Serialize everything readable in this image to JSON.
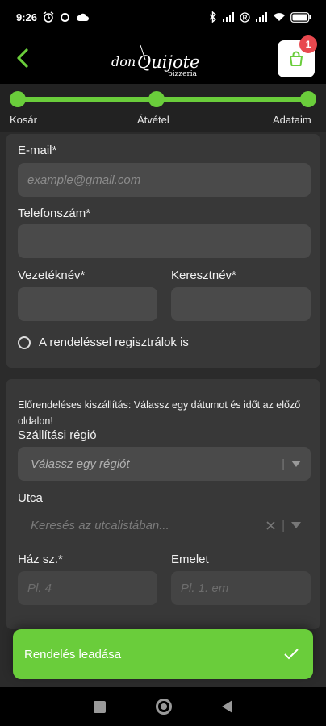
{
  "status_bar": {
    "time": "9:26",
    "battery": "96"
  },
  "header": {
    "logo_text_don": "don",
    "logo_text_quijote": "Quijote",
    "logo_text_pizzeria": "pizzeria",
    "cart_badge": "1"
  },
  "progress": {
    "steps": [
      "Kosár",
      "Átvétel",
      "Adataim"
    ],
    "completed_fraction": 1.0
  },
  "contact": {
    "email_label": "E-mail*",
    "email_placeholder": "example@gmail.com",
    "phone_label": "Telefonszám*",
    "phone_value": "",
    "lastname_label": "Vezetéknév*",
    "lastname_value": "",
    "firstname_label": "Keresztnév*",
    "firstname_value": "",
    "register_label": "A rendeléssel regisztrálok is",
    "register_checked": false
  },
  "delivery": {
    "note": "Előrendeléses kiszállítás: Válassz egy dátumot és időt az előző oldalon!",
    "region_label": "Szállítási régió",
    "region_placeholder": "Válassz egy régiót",
    "street_label": "Utca",
    "street_placeholder": "Keresés az utcalistában...",
    "house_label": "Ház sz.*",
    "house_placeholder": "Pl. 4",
    "floor_label": "Emelet",
    "floor_placeholder": "Pl. 1. em"
  },
  "order_button": {
    "label": "Rendelés leadása"
  },
  "colors": {
    "accent": "#6acd3b",
    "badge": "#e8484e",
    "card": "#383838",
    "input": "#4a4a4a"
  }
}
